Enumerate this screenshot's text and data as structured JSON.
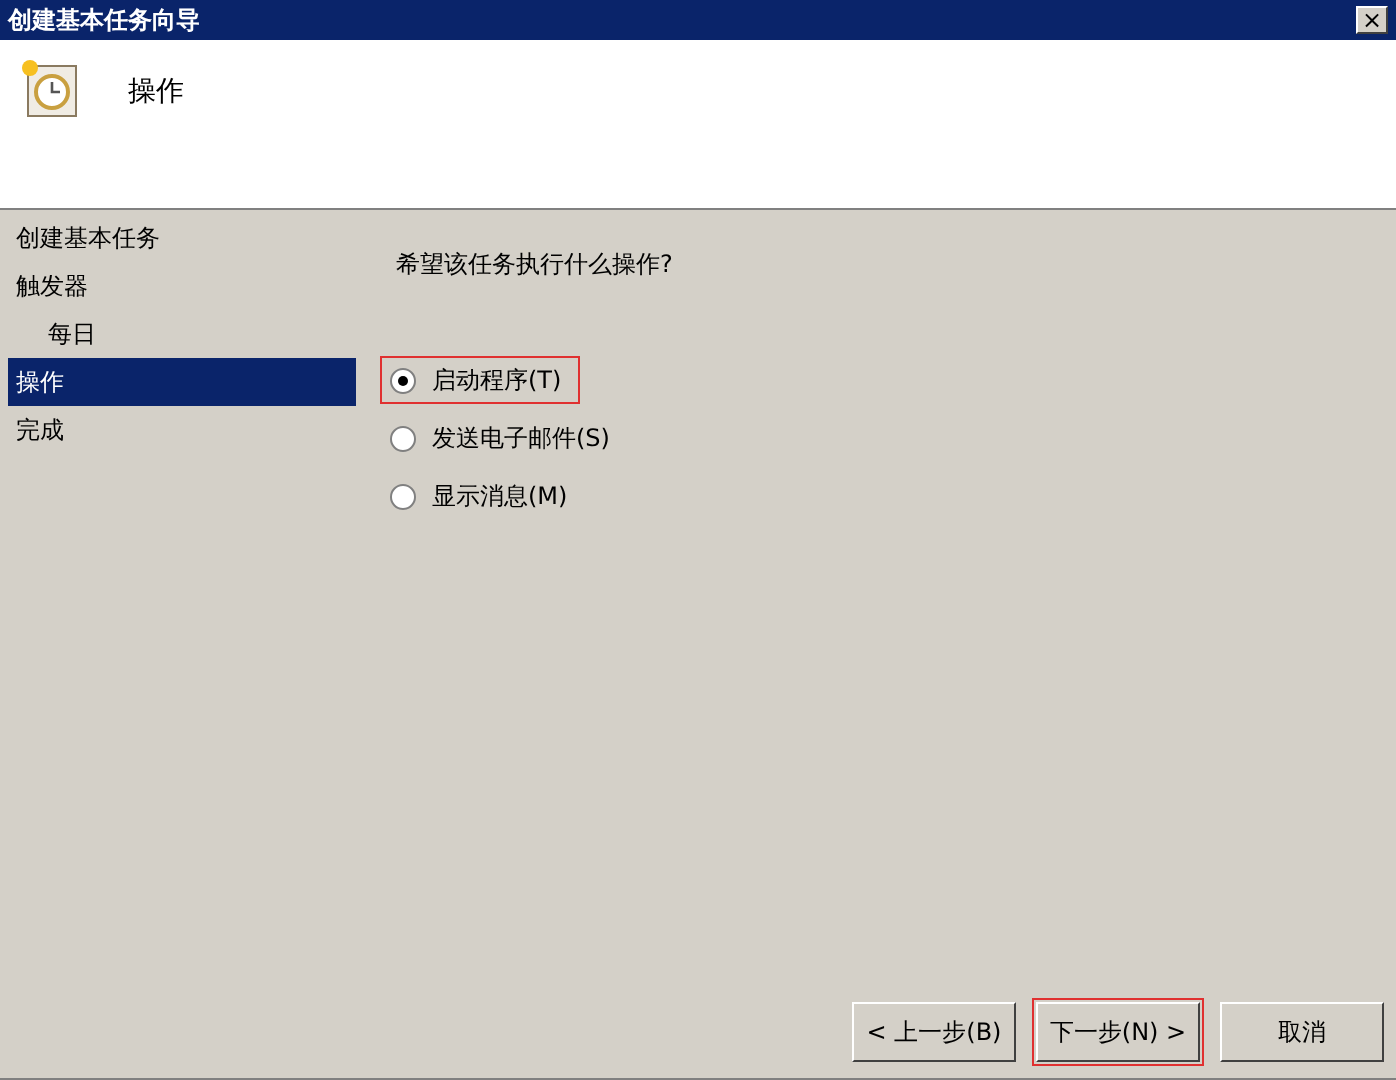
{
  "window": {
    "title": "创建基本任务向导",
    "close": "×"
  },
  "header": {
    "title": "操作"
  },
  "sidebar": {
    "items": [
      {
        "label": "创建基本任务",
        "selected": false
      },
      {
        "label": "触发器",
        "selected": false,
        "children": [
          {
            "label": "每日",
            "selected": false
          }
        ]
      },
      {
        "label": "操作",
        "selected": true
      },
      {
        "label": "完成",
        "selected": false
      }
    ]
  },
  "question": "希望该任务执行什么操作?",
  "options": [
    {
      "label": "启动程序(T)",
      "selected": true,
      "highlighted": true
    },
    {
      "label": "发送电子邮件(S)",
      "selected": false,
      "highlighted": false
    },
    {
      "label": "显示消息(M)",
      "selected": false,
      "highlighted": false
    }
  ],
  "buttons": [
    {
      "label": "< 上一步(B)",
      "highlighted": false
    },
    {
      "label": "下一步(N) >",
      "highlighted": true
    },
    {
      "label": "取消",
      "highlighted": false
    }
  ]
}
